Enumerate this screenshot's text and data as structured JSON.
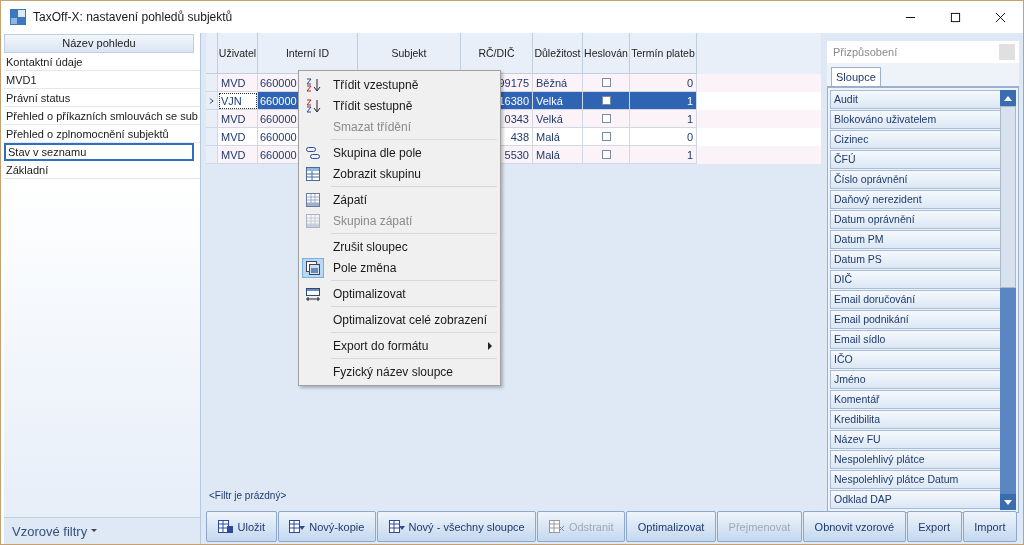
{
  "window": {
    "title": "TaxOff-X: nastavení pohledů subjektů"
  },
  "views": {
    "header": "Název pohledu",
    "items": [
      {
        "label": "Kontaktní údaje",
        "selected": false
      },
      {
        "label": "MVD1",
        "selected": false
      },
      {
        "label": "Právní status",
        "selected": false
      },
      {
        "label": "Přehled o příkazních smlouvách se sub",
        "selected": false
      },
      {
        "label": "Přehled o zplnomocnění subjektů",
        "selected": false
      },
      {
        "label": "Stav v seznamu",
        "selected": true
      },
      {
        "label": "Základní",
        "selected": false
      }
    ],
    "footer": "Vzorové filtry"
  },
  "grid": {
    "columns": [
      "Uživatel",
      "Interní ID",
      "Subjekt",
      "RČ/DIČ",
      "Důležitost",
      "Heslován",
      "Termín plateb"
    ],
    "rows": [
      {
        "user": "MVD",
        "id": "660000",
        "rc": "99175",
        "importance": "Běžná",
        "checked": false,
        "term": "0",
        "selected": false
      },
      {
        "user": "VJN",
        "id": "660000",
        "rc": "16380",
        "importance": "Velká",
        "checked": false,
        "term": "1",
        "selected": true
      },
      {
        "user": "MVD",
        "id": "660000",
        "rc": "0343",
        "importance": "Velká",
        "checked": false,
        "term": "1",
        "selected": false
      },
      {
        "user": "MVD",
        "id": "660000",
        "rc": "438",
        "importance": "Malá",
        "checked": false,
        "term": "0",
        "selected": false
      },
      {
        "user": "MVD",
        "id": "660000",
        "rc": "5530",
        "importance": "Malá",
        "checked": false,
        "term": "1",
        "selected": false
      }
    ],
    "filter": "<Filtr je prázdný>"
  },
  "context_menu": [
    {
      "kind": "item",
      "label": "Třídit vzestupně",
      "disabled": false
    },
    {
      "kind": "item",
      "label": "Třídit  sestupně",
      "disabled": false
    },
    {
      "kind": "item",
      "label": "Smazat třídění",
      "disabled": true
    },
    {
      "kind": "separator"
    },
    {
      "kind": "item",
      "label": "Skupina dle pole",
      "disabled": false
    },
    {
      "kind": "item",
      "label": "Zobrazit skupinu",
      "disabled": false
    },
    {
      "kind": "separator"
    },
    {
      "kind": "item",
      "label": "Zápatí",
      "disabled": false
    },
    {
      "kind": "item",
      "label": "Skupina zápatí",
      "disabled": true
    },
    {
      "kind": "separator"
    },
    {
      "kind": "item",
      "label": "Zrušit sloupec",
      "disabled": false
    },
    {
      "kind": "item",
      "label": "Pole změna",
      "disabled": false,
      "checked": true
    },
    {
      "kind": "separator"
    },
    {
      "kind": "item",
      "label": "Optimalizovat",
      "disabled": false
    },
    {
      "kind": "separator"
    },
    {
      "kind": "item",
      "label": "Optimalizovat celé zobrazení",
      "disabled": false
    },
    {
      "kind": "separator"
    },
    {
      "kind": "item",
      "label": "Export do formátu",
      "disabled": false,
      "submenu": true
    },
    {
      "kind": "separator"
    },
    {
      "kind": "item",
      "label": "Fyzický název sloupce",
      "disabled": false
    }
  ],
  "customize": {
    "title": "Přizpůsobení",
    "tabs": [
      {
        "label": "Sloupce",
        "selected": true
      }
    ],
    "columns": [
      "Audit",
      "Blokováno uživatelem",
      "Cizinec",
      "ČFÚ",
      "Číslo oprávnění",
      "Daňový nerezident",
      "Datum oprávnění",
      "Datum PM",
      "Datum PS",
      "DIČ",
      "Email doručování",
      "Email podnikání",
      "Email sídlo",
      "IČO",
      "Jméno",
      "Komentář",
      "Kredibilita",
      "Název FU",
      "Nespolehlivý plátce",
      "Nespolehlivý plátce Datum",
      "Odklad DAP"
    ]
  },
  "buttons": [
    {
      "label": "Uložit",
      "disabled": false
    },
    {
      "label": "Nový-kopie",
      "disabled": false
    },
    {
      "label": "Nový - všechny sloupce",
      "disabled": false
    },
    {
      "label": "Odstranit",
      "disabled": true
    },
    {
      "label": "Optimalizovat",
      "disabled": false
    },
    {
      "label": "Přejmenovat",
      "disabled": true
    },
    {
      "label": "Obnovit vzorové",
      "disabled": false
    },
    {
      "label": "Export",
      "disabled": false
    },
    {
      "label": "Import",
      "disabled": false
    }
  ]
}
